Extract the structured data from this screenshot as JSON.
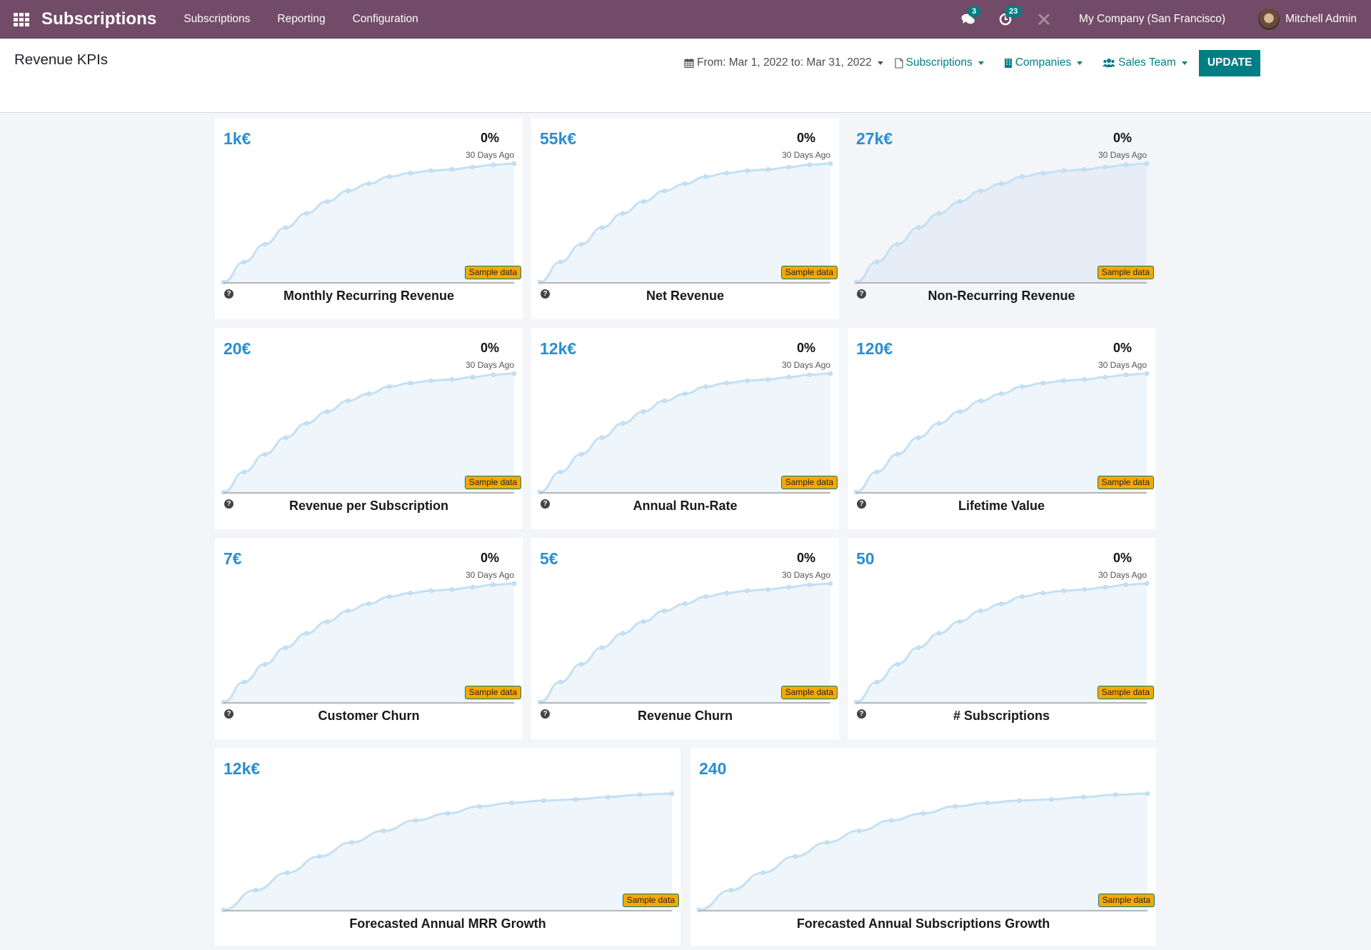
{
  "navbar": {
    "app_title": "Subscriptions",
    "menu": [
      "Subscriptions",
      "Reporting",
      "Configuration"
    ],
    "messages_count": "3",
    "activities_count": "23",
    "company": "My Company (San Francisco)",
    "user": "Mitchell Admin"
  },
  "control_panel": {
    "title": "Revenue KPIs",
    "date_filter": "From: Mar 1, 2022 to: Mar 31, 2022",
    "filters": [
      "Subscriptions",
      "Companies",
      "Sales Team"
    ],
    "update_label": "UPDATE"
  },
  "colors": {
    "navbar": "#714B67",
    "accent": "#017e84",
    "kpi_value": "#2a8ed0",
    "sample_badge": "#f7a800",
    "line": "#c5e0f3",
    "fill": "#eef6fb"
  },
  "sample_badge_label": "Sample data",
  "trend_sublabel": "30 Days Ago",
  "chart_data": {
    "type": "line",
    "note": "All KPI sparklines show the same sample-data curve (normalized 0-1)",
    "x": [
      0,
      1,
      2,
      3,
      4,
      5,
      6,
      7,
      8,
      9,
      10,
      11,
      12,
      13,
      14
    ],
    "values": [
      0,
      0.17,
      0.32,
      0.46,
      0.58,
      0.68,
      0.77,
      0.83,
      0.89,
      0.92,
      0.94,
      0.95,
      0.97,
      0.99,
      1.0
    ],
    "ylim": [
      0,
      1
    ],
    "grid": false
  },
  "kpis": [
    {
      "value": "1k€",
      "trend": "0%",
      "label": "Monthly Recurring Revenue",
      "hover": false
    },
    {
      "value": "55k€",
      "trend": "0%",
      "label": "Net Revenue",
      "hover": false
    },
    {
      "value": "27k€",
      "trend": "0%",
      "label": "Non-Recurring Revenue",
      "hover": true
    },
    {
      "value": "20€",
      "trend": "0%",
      "label": "Revenue per Subscription",
      "hover": false
    },
    {
      "value": "12k€",
      "trend": "0%",
      "label": "Annual Run-Rate",
      "hover": false
    },
    {
      "value": "120€",
      "trend": "0%",
      "label": "Lifetime Value",
      "hover": false
    },
    {
      "value": "7€",
      "trend": "0%",
      "label": "Customer Churn",
      "hover": false
    },
    {
      "value": "5€",
      "trend": "0%",
      "label": "Revenue Churn",
      "hover": false
    },
    {
      "value": "50",
      "trend": "0%",
      "label": "# Subscriptions",
      "hover": false
    }
  ],
  "forecasts": [
    {
      "value": "12k€",
      "label": "Forecasted Annual MRR Growth"
    },
    {
      "value": "240",
      "label": "Forecasted Annual Subscriptions Growth"
    }
  ]
}
